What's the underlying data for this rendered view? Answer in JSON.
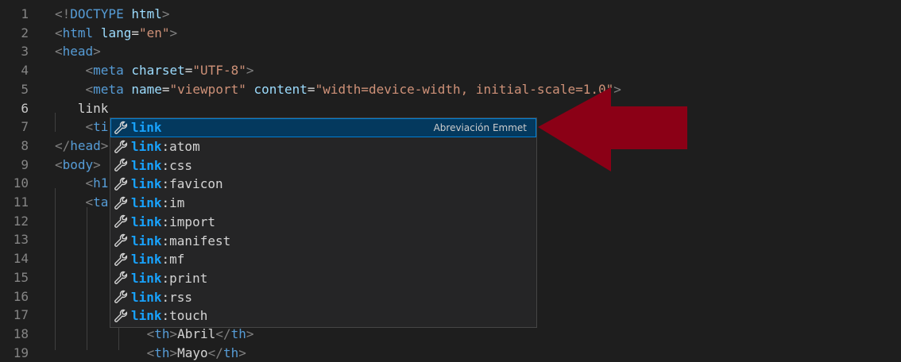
{
  "editor": {
    "line_numbers": [
      "1",
      "2",
      "3",
      "4",
      "5",
      "6",
      "7",
      "8",
      "9",
      "10",
      "11",
      "12",
      "13",
      "14",
      "15",
      "16",
      "17",
      "18",
      "19"
    ],
    "current_line": "6",
    "lines": [
      [
        {
          "c": "punc",
          "t": "<!"
        },
        {
          "c": "tag",
          "t": "DOCTYPE"
        },
        {
          "c": "txt",
          "t": " "
        },
        {
          "c": "attr",
          "t": "html"
        },
        {
          "c": "punc",
          "t": ">"
        }
      ],
      [
        {
          "c": "punc",
          "t": "<"
        },
        {
          "c": "tag",
          "t": "html"
        },
        {
          "c": "txt",
          "t": " "
        },
        {
          "c": "attr",
          "t": "lang"
        },
        {
          "c": "txt",
          "t": "="
        },
        {
          "c": "str",
          "t": "\"en\""
        },
        {
          "c": "punc",
          "t": ">"
        }
      ],
      [
        {
          "c": "punc",
          "t": "<"
        },
        {
          "c": "tag",
          "t": "head"
        },
        {
          "c": "punc",
          "t": ">"
        }
      ],
      [
        {
          "c": "txt",
          "t": "    "
        },
        {
          "c": "punc",
          "t": "<"
        },
        {
          "c": "tag",
          "t": "meta"
        },
        {
          "c": "txt",
          "t": " "
        },
        {
          "c": "attr",
          "t": "charset"
        },
        {
          "c": "txt",
          "t": "="
        },
        {
          "c": "str",
          "t": "\"UTF-8\""
        },
        {
          "c": "punc",
          "t": ">"
        }
      ],
      [
        {
          "c": "txt",
          "t": "    "
        },
        {
          "c": "punc",
          "t": "<"
        },
        {
          "c": "tag",
          "t": "meta"
        },
        {
          "c": "txt",
          "t": " "
        },
        {
          "c": "attr",
          "t": "name"
        },
        {
          "c": "txt",
          "t": "="
        },
        {
          "c": "str",
          "t": "\"viewport\""
        },
        {
          "c": "txt",
          "t": " "
        },
        {
          "c": "attr",
          "t": "content"
        },
        {
          "c": "txt",
          "t": "="
        },
        {
          "c": "str",
          "t": "\"width=device-width, initial-scale=1.0\""
        },
        {
          "c": "punc",
          "t": ">"
        }
      ],
      [
        {
          "c": "txt",
          "t": "   link"
        }
      ],
      [
        {
          "c": "txt",
          "t": "    "
        },
        {
          "c": "punc",
          "t": "<"
        },
        {
          "c": "tag",
          "t": "ti"
        }
      ],
      [
        {
          "c": "punc",
          "t": "</"
        },
        {
          "c": "tag",
          "t": "head"
        },
        {
          "c": "punc",
          "t": ">"
        }
      ],
      [
        {
          "c": "punc",
          "t": "<"
        },
        {
          "c": "tag",
          "t": "body"
        },
        {
          "c": "punc",
          "t": ">"
        }
      ],
      [
        {
          "c": "txt",
          "t": "    "
        },
        {
          "c": "punc",
          "t": "<"
        },
        {
          "c": "tag",
          "t": "h1"
        }
      ],
      [
        {
          "c": "txt",
          "t": "    "
        },
        {
          "c": "punc",
          "t": "<"
        },
        {
          "c": "tag",
          "t": "ta"
        }
      ],
      [],
      [],
      [],
      [],
      [],
      [],
      [
        {
          "c": "txt",
          "t": "            "
        },
        {
          "c": "punc",
          "t": "<"
        },
        {
          "c": "tag",
          "t": "th"
        },
        {
          "c": "punc",
          "t": ">"
        },
        {
          "c": "txt",
          "t": "Abril"
        },
        {
          "c": "punc",
          "t": "</"
        },
        {
          "c": "tag",
          "t": "th"
        },
        {
          "c": "punc",
          "t": ">"
        }
      ],
      [
        {
          "c": "txt",
          "t": "            "
        },
        {
          "c": "punc",
          "t": "<"
        },
        {
          "c": "tag",
          "t": "th"
        },
        {
          "c": "punc",
          "t": ">"
        },
        {
          "c": "txt",
          "t": "Mayo"
        },
        {
          "c": "punc",
          "t": "</"
        },
        {
          "c": "tag",
          "t": "th"
        },
        {
          "c": "punc",
          "t": ">"
        }
      ]
    ]
  },
  "suggest": {
    "match": "link",
    "selected_detail": "Abreviación Emmet",
    "items": [
      {
        "match": "link",
        "rest": ""
      },
      {
        "match": "link",
        "rest": ":atom"
      },
      {
        "match": "link",
        "rest": ":css"
      },
      {
        "match": "link",
        "rest": ":favicon"
      },
      {
        "match": "link",
        "rest": ":im"
      },
      {
        "match": "link",
        "rest": ":import"
      },
      {
        "match": "link",
        "rest": ":manifest"
      },
      {
        "match": "link",
        "rest": ":mf"
      },
      {
        "match": "link",
        "rest": ":print"
      },
      {
        "match": "link",
        "rest": ":rss"
      },
      {
        "match": "link",
        "rest": ":touch"
      }
    ],
    "icon": "wrench-icon"
  },
  "annotation": {
    "icon": "arrow-left-icon",
    "color": "#8b0016"
  }
}
